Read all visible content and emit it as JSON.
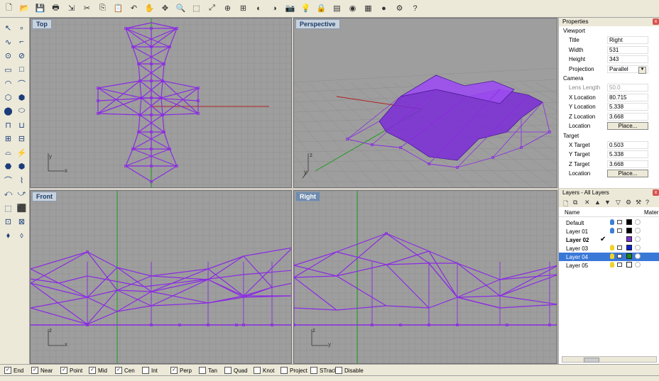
{
  "toolbar": {
    "icons": [
      "new-icon",
      "open-icon",
      "save-icon",
      "print-icon",
      "import-icon",
      "cut-icon",
      "copy-icon",
      "paste-icon",
      "undo-icon",
      "pan-icon",
      "move-icon",
      "zoom-icon",
      "zoom-window-icon",
      "zoom-extents-icon",
      "zoom-selected-icon",
      "four-viewports-icon",
      "hide-icon",
      "show-icon",
      "camera-icon",
      "light-icon",
      "lock-icon",
      "layer-icon",
      "color-icon",
      "grid-icon",
      "render-icon",
      "options-icon",
      "help-icon"
    ]
  },
  "viewports": {
    "top": {
      "label": "Top",
      "axis_y": "y",
      "axis_x": "x"
    },
    "perspective": {
      "label": "Perspective",
      "axis_y": "z",
      "axis_x": "y"
    },
    "front": {
      "label": "Front",
      "axis_y": "z",
      "axis_x": "x"
    },
    "right": {
      "label": "Right",
      "axis_y": "z",
      "axis_x": "y"
    }
  },
  "properties": {
    "panel_title": "Properties",
    "close": "x",
    "viewport_section": "Viewport",
    "title_label": "Title",
    "title_value": "Right",
    "width_label": "Width",
    "width_value": "531",
    "height_label": "Height",
    "height_value": "343",
    "projection_label": "Projection",
    "projection_value": "Parallel",
    "camera_section": "Camera",
    "lens_label": "Lens Length",
    "lens_value": "50.0",
    "cx_label": "X Location",
    "cx_value": "80.715",
    "cy_label": "Y Location",
    "cy_value": "5.338",
    "cz_label": "Z Location",
    "cz_value": "3.668",
    "cloc_label": "Location",
    "cloc_button": "Place...",
    "target_section": "Target",
    "tx_label": "X Target",
    "tx_value": "0.503",
    "ty_label": "Y Target",
    "ty_value": "5.338",
    "tz_label": "Z Target",
    "tz_value": "3.668",
    "tloc_label": "Location",
    "tloc_button": "Place..."
  },
  "layers": {
    "panel_title": "Layers - All Layers",
    "close": "x",
    "col_name": "Name",
    "col_material": "Mater",
    "help": "?",
    "rows": [
      {
        "name": "Default",
        "color": "#000000",
        "bulb": "#3d7fd6"
      },
      {
        "name": "Layer 01",
        "color": "#000000",
        "bulb": "#3d7fd6"
      },
      {
        "name": "Layer 02",
        "color": "#7b2fd0",
        "bulb": "",
        "current": "✔"
      },
      {
        "name": "Layer 03",
        "color": "#0a1ed8",
        "bulb": "#f0d22a"
      },
      {
        "name": "Layer 04",
        "color": "#1a8a1a",
        "bulb": "#f0d22a"
      },
      {
        "name": "Layer 05",
        "color": "#ffffff",
        "bulb": "#f0d22a"
      }
    ]
  },
  "osnap": {
    "items": [
      {
        "label": "End",
        "checked": "✓"
      },
      {
        "label": "Near",
        "checked": "✓"
      },
      {
        "label": "Point",
        "checked": "✓"
      },
      {
        "label": "Mid",
        "checked": "✓"
      },
      {
        "label": "Cen",
        "checked": "✓"
      },
      {
        "label": "Int",
        "checked": ""
      },
      {
        "label": "Perp",
        "checked": "✓"
      },
      {
        "label": "Tan",
        "checked": ""
      },
      {
        "label": "Quad",
        "checked": ""
      },
      {
        "label": "Knot",
        "checked": ""
      },
      {
        "label": "Project",
        "checked": ""
      },
      {
        "label": "STrack",
        "checked": ""
      },
      {
        "label": "Disable",
        "checked": ""
      }
    ]
  },
  "colors": {
    "wire": "#8a2be2",
    "axis_red": "#b22222",
    "axis_green": "#1e9b1e",
    "selected": "#3a78d8"
  }
}
